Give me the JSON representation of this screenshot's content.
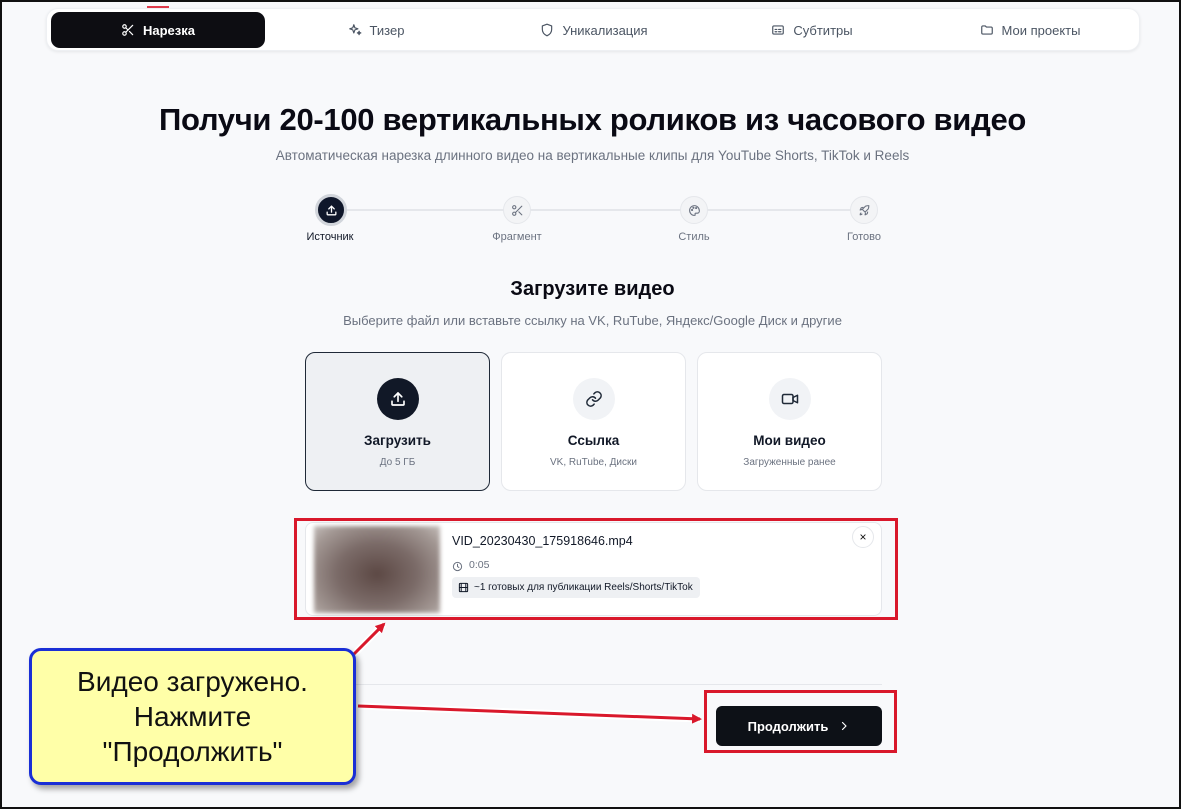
{
  "nav": {
    "tabs": [
      {
        "label": "Нарезка",
        "icon": "scissors-icon",
        "active": true
      },
      {
        "label": "Тизер",
        "icon": "sparkles-icon",
        "active": false
      },
      {
        "label": "Уникализация",
        "icon": "shield-icon",
        "active": false
      },
      {
        "label": "Субтитры",
        "icon": "captions-icon",
        "active": false
      },
      {
        "label": "Мои проекты",
        "icon": "folder-icon",
        "active": false
      }
    ]
  },
  "hero": {
    "title": "Получи 20-100 вертикальных роликов из часового видео",
    "subtitle": "Автоматическая нарезка длинного видео на вертикальные клипы для YouTube Shorts, TikTok и Reels"
  },
  "stepper": {
    "steps": [
      {
        "label": "Источник",
        "icon": "upload-icon",
        "active": true
      },
      {
        "label": "Фрагмент",
        "icon": "scissors-icon",
        "active": false
      },
      {
        "label": "Стиль",
        "icon": "palette-icon",
        "active": false
      },
      {
        "label": "Готово",
        "icon": "rocket-icon",
        "active": false
      }
    ]
  },
  "upload": {
    "title": "Загрузите видео",
    "subtitle": "Выберите файл или вставьте ссылку на VK, RuTube, Яндекс/Google Диск и другие",
    "options": [
      {
        "title": "Загрузить",
        "sub": "До 5 ГБ",
        "icon": "upload-icon",
        "selected": true
      },
      {
        "title": "Ссылка",
        "sub": "VK, RuTube, Диски",
        "icon": "link-icon",
        "selected": false
      },
      {
        "title": "Мои видео",
        "sub": "Загруженные ранее",
        "icon": "video-camera-icon",
        "selected": false
      }
    ]
  },
  "file": {
    "name": "VID_20230430_175918646.mp4",
    "duration": "0:05",
    "badge": "~1 готовых для публикации Reels/Shorts/TikTok",
    "close": "×"
  },
  "actions": {
    "continue_label": "Продолжить"
  },
  "callout": {
    "text": "Видео загружено. Нажмите \"Продолжить\""
  },
  "colors": {
    "accent_dark": "#0d1117",
    "highlight_red": "#d9182b",
    "callout_bg": "#ffffa8",
    "callout_border": "#1a2fd6"
  }
}
